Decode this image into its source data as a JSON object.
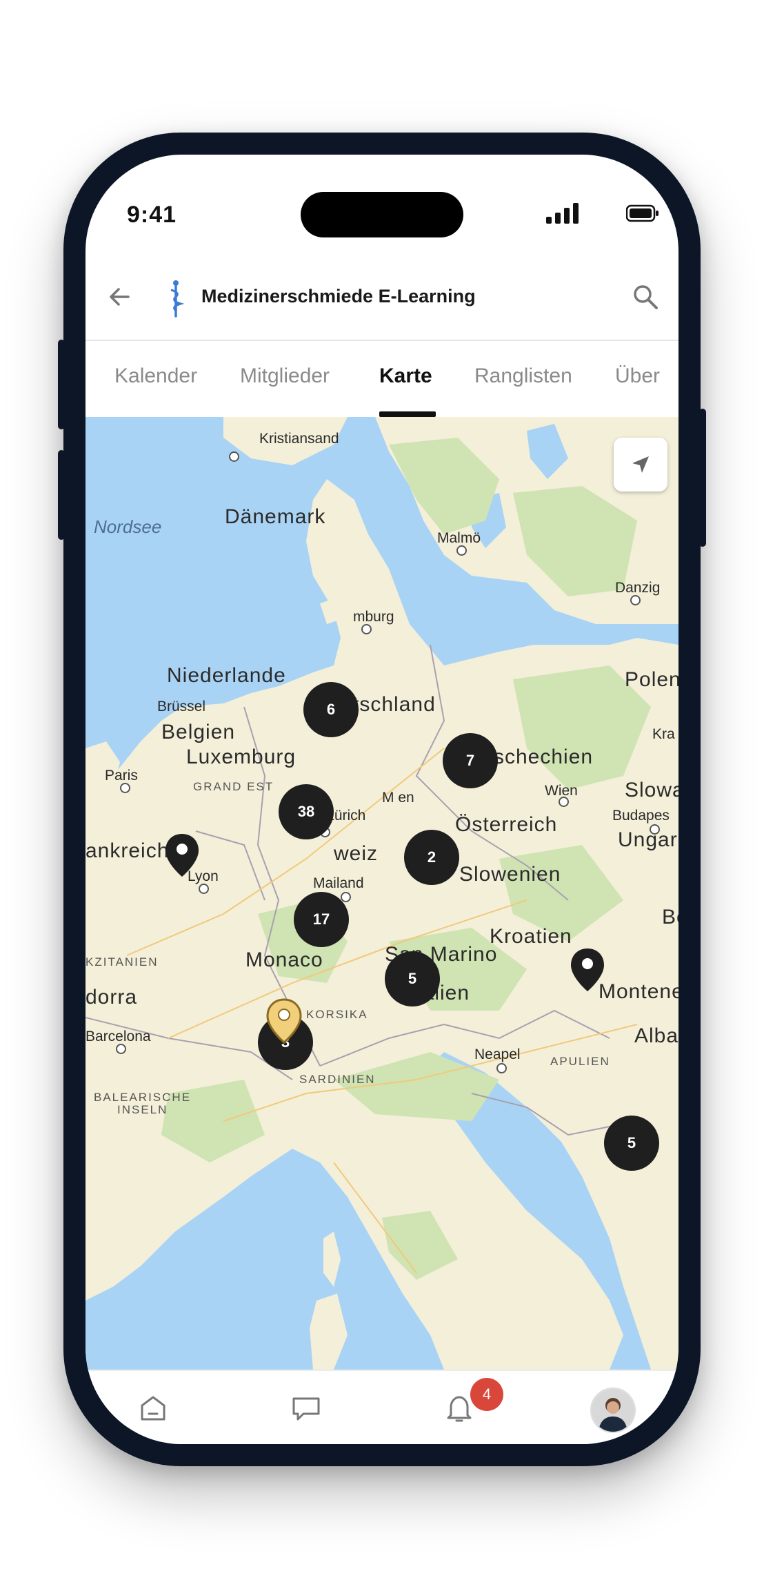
{
  "status": {
    "time": "9:41"
  },
  "header": {
    "title": "Medizinerschmiede E-Learning",
    "back_icon": "arrow-left-icon",
    "search_icon": "search-icon",
    "logo_icon": "caduceus-logo-icon"
  },
  "tabs": [
    {
      "label": "Kalender",
      "active": false
    },
    {
      "label": "Mitglieder",
      "active": false
    },
    {
      "label": "Karte",
      "active": true
    },
    {
      "label": "Ranglisten",
      "active": false
    },
    {
      "label": "Über",
      "active": false
    }
  ],
  "map": {
    "labels": {
      "kristiansand": "Kristiansand",
      "nordsee": "Nordsee",
      "daenemark": "Dänemark",
      "malmo": "Malmö",
      "danzig": "Danzig",
      "hamburg": "mburg",
      "niederlande": "Niederlande",
      "polen": "Polen",
      "brussel": "Brüssel",
      "deutschland": "Deutschland",
      "belgien": "Belgien",
      "luxemburg": "Luxemburg",
      "tschechien": "Tschechien",
      "krakau": "Kra",
      "paris": "Paris",
      "grandest": "GRAND EST",
      "wien": "Wien",
      "slowakei": "Slowa",
      "budapest": "Budapes",
      "muenchen": "M   en",
      "oesterreich": "Österreich",
      "ungarn": "Ungarn",
      "zurich": "Zürich",
      "frankreich": "ankreich",
      "schweiz": "weiz",
      "lyon": "Lyon",
      "mailand": "Mailand",
      "slowenien": "Slowenien",
      "kroatien": "Kroatien",
      "belgrad": "Be",
      "okzitanien": "KZITANIEN",
      "monaco": "Monaco",
      "sanmarino": "San Marino",
      "dorra": "dorra",
      "italien": "Italien",
      "montenegro": "Montene",
      "korsika": "KORSIKA",
      "barcelona": "Barcelona",
      "neapel": "Neapel",
      "apulien": "APULIEN",
      "albanien": "Alba",
      "sardinien": "SARDINIEN",
      "balearische": "BALEARISCHE",
      "inseln": "INSELN"
    },
    "clusters": [
      {
        "count": "6"
      },
      {
        "count": "7"
      },
      {
        "count": "38"
      },
      {
        "count": "2"
      },
      {
        "count": "17"
      },
      {
        "count": "5"
      },
      {
        "count": "3"
      },
      {
        "count": "5"
      }
    ],
    "location_button_icon": "navigation-arrow-icon"
  },
  "bottom_nav": {
    "items": [
      "home-icon",
      "chat-icon",
      "bell-icon",
      "profile-avatar"
    ],
    "notification_count": "4"
  },
  "colors": {
    "water": "#a9d3f5",
    "land": "#f3efd9",
    "forest": "#cfe3b3",
    "cluster": "#1f1f1f",
    "badge": "#d9473b",
    "pin_gold": "#f2cf7a"
  }
}
